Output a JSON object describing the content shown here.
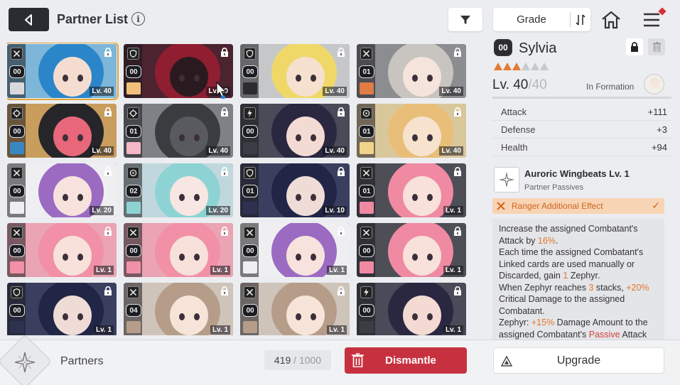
{
  "header": {
    "title": "Partner List",
    "info": "i",
    "grade_label": "Grade"
  },
  "cards": [
    {
      "ovl": "00",
      "lv": "Lv. 40",
      "selected": true,
      "hair": "#2b86c9",
      "bg": "#7db6d8",
      "skin": "#f4dcd0",
      "portrait": "#d9d9dc",
      "cls": "sword"
    },
    {
      "ovl": "00",
      "lv": "Lv. 40",
      "selected": false,
      "hair": "#8f1e31",
      "bg": "#4b2430",
      "skin": "#2a1a1f",
      "portrait": "#f0c07a",
      "cls": "shield"
    },
    {
      "ovl": "00",
      "lv": "Lv. 40",
      "selected": false,
      "hair": "#f0d868",
      "bg": "#c6c7c9",
      "skin": "#f6e0cf",
      "portrait": "#2c2c30",
      "cls": "shield"
    },
    {
      "ovl": "01",
      "lv": "Lv. 40",
      "selected": false,
      "hair": "#c8c4bf",
      "bg": "#8c8d91",
      "skin": "#f4e4db",
      "portrait": "#e07c44",
      "cls": "sword"
    },
    {
      "ovl": "00",
      "lv": "Lv. 40",
      "selected": false,
      "hair": "#26262a",
      "bg": "#c99d5e",
      "skin": "#e8677a",
      "portrait": "#3a86c2",
      "cls": "target"
    },
    {
      "ovl": "01",
      "lv": "Lv. 40",
      "selected": false,
      "hair": "#3b3c40",
      "bg": "#7f8186",
      "skin": "#595a5f",
      "portrait": "#f4b7c7",
      "cls": "target"
    },
    {
      "ovl": "00",
      "lv": "Lv. 40",
      "selected": false,
      "hair": "#2a2840",
      "bg": "#4a4a58",
      "skin": "#f3dad3",
      "portrait": "#3c3d44",
      "cls": "bolt"
    },
    {
      "ovl": "01",
      "lv": "Lv. 40",
      "selected": false,
      "hair": "#e9be78",
      "bg": "#d9c79c",
      "skin": "#f6e2cd",
      "portrait": "#f0d48a",
      "cls": "ring"
    },
    {
      "ovl": "00",
      "lv": "Lv. 20",
      "selected": false,
      "hair": "#9b6bc2",
      "bg": "#efeff2",
      "skin": "#f7e2dd",
      "portrait": "#efeff2",
      "cls": "sword"
    },
    {
      "ovl": "02",
      "lv": "Lv. 20",
      "selected": false,
      "hair": "#8ed3d3",
      "bg": "#c0d8dd",
      "skin": "#f7e6e1",
      "portrait": "#8ed3d3",
      "cls": "ring"
    },
    {
      "ovl": "01",
      "lv": "Lv. 10",
      "selected": false,
      "hair": "#222646",
      "bg": "#3b3f5f",
      "skin": "#f0dcd6",
      "portrait": "#2e3150",
      "cls": "shield"
    },
    {
      "ovl": "01",
      "lv": "Lv. 1",
      "selected": false,
      "hair": "#f08aa3",
      "bg": "#4e4e57",
      "skin": "#f7e1da",
      "portrait": "#f08aa3",
      "cls": "sword"
    },
    {
      "ovl": "00",
      "lv": "Lv. 1",
      "selected": false,
      "hair": "#f290a7",
      "bg": "#eaa4b3",
      "skin": "#f7e1da",
      "portrait": "#f290a7",
      "cls": "sword"
    },
    {
      "ovl": "00",
      "lv": "Lv. 1",
      "selected": false,
      "hair": "#f290a7",
      "bg": "#eaa4b3",
      "skin": "#f7e1da",
      "portrait": "#f290a7",
      "cls": "sword"
    },
    {
      "ovl": "00",
      "lv": "Lv. 1",
      "selected": false,
      "hair": "#9b6bc2",
      "bg": "#efeff2",
      "skin": "#f7e2dd",
      "portrait": "#efeff2",
      "cls": "sword"
    },
    {
      "ovl": "00",
      "lv": "Lv. 1",
      "selected": false,
      "hair": "#f08aa3",
      "bg": "#4e4e57",
      "skin": "#f7e1da",
      "portrait": "#f08aa3",
      "cls": "sword"
    },
    {
      "ovl": "00",
      "lv": "Lv. 1",
      "selected": false,
      "hair": "#222646",
      "bg": "#3b3f5f",
      "skin": "#f0dcd6",
      "portrait": "#2e3150",
      "cls": "shield"
    },
    {
      "ovl": "04",
      "lv": "Lv. 1",
      "selected": false,
      "hair": "#b59d89",
      "bg": "#cfc4ba",
      "skin": "#f6e4d8",
      "portrait": "#b59d89",
      "cls": "sword"
    },
    {
      "ovl": "00",
      "lv": "Lv. 1",
      "selected": false,
      "hair": "#b59d89",
      "bg": "#cfc4ba",
      "skin": "#f6e4d8",
      "portrait": "#b59d89",
      "cls": "sword"
    },
    {
      "ovl": "00",
      "lv": "Lv. 1",
      "selected": false,
      "hair": "#2a2840",
      "bg": "#4a4a58",
      "skin": "#f3dad3",
      "portrait": "#3c3d44",
      "cls": "bolt"
    }
  ],
  "detail": {
    "overload": "00",
    "name": "Sylvia",
    "stars_filled": 3,
    "stars_total": 6,
    "level": "Lv. 40",
    "level_max": "/40",
    "formation": "In Formation",
    "stats": [
      {
        "key": "Attack",
        "value": "+111"
      },
      {
        "key": "Defense",
        "value": "+3"
      },
      {
        "key": "Health",
        "value": "+94"
      }
    ],
    "passive_name": "Auroric Wingbeats Lv. 1",
    "passive_sub": "Partner Passives",
    "ranger_effect": "Ranger Additional Effect",
    "desc": {
      "p1a": "Increase the assigned Combatant's Attack by ",
      "p1b": "16%",
      "p1c": ".",
      "p2a": "Each time the assigned Combatant's Linked cards are used manually or Discarded, gain ",
      "p2b": "1",
      "p2c": " Zephyr.",
      "p3a": "When Zephyr reaches ",
      "p3b": "3",
      "p3c": " stacks, ",
      "p3d": "+20%",
      "p3e": " Critical Damage to the assigned Combatant.",
      "p4a": "Zephyr: ",
      "p4b": "+15%",
      "p4c": " Damage Amount to the assigned Combatant's ",
      "p4d": "Passive",
      "p4e": " Attack"
    }
  },
  "footer": {
    "partners_label": "Partners",
    "count_current": "419",
    "count_sep": " / ",
    "count_max": "1000",
    "dismantle_label": "Dismantle",
    "upgrade_label": "Upgrade"
  },
  "colors": {
    "accent_orange": "#e2762a",
    "dismantle_red": "#c7313f",
    "selection_gold": "#e0a63a"
  }
}
